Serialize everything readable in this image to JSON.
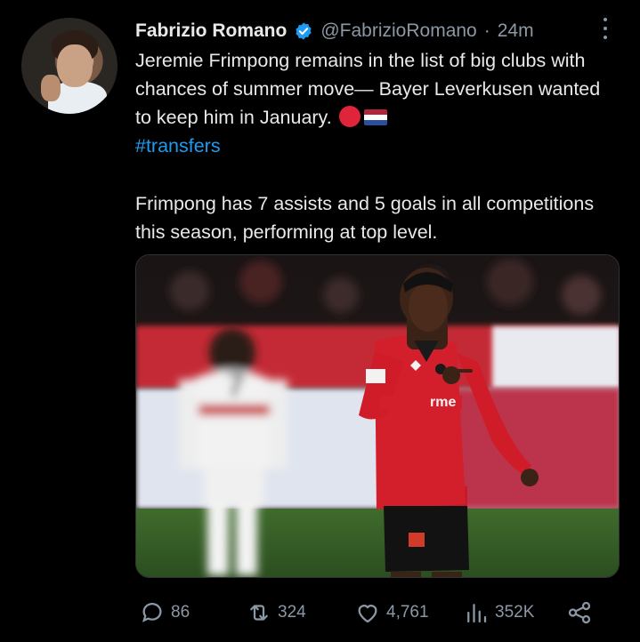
{
  "tweet": {
    "author": {
      "display_name": "Fabrizio Romano",
      "handle": "@FabrizioRomano",
      "separator": "·",
      "time_ago": "24m",
      "verified_icon": "verified-badge-icon"
    },
    "text": {
      "line1": "Jeremie Frimpong remains in the list of big clubs with chances of summer move— Bayer Leverkusen wanted to keep him in January.",
      "flags": [
        "red-circle-emoji",
        "netherlands-flag-emoji"
      ],
      "hashtag": "#transfers",
      "paragraph2": "Frimpong has 7 assists and 5 goals in all competitions this season, performing at top level."
    },
    "media": {
      "shirt_text": "rme",
      "back_number": "7"
    },
    "actions": {
      "replies": "86",
      "retweets": "324",
      "likes": "4,761",
      "views": "352K"
    }
  },
  "colors": {
    "background": "#000000",
    "text": "#e7e9ea",
    "secondary_text": "#8b98a5",
    "link": "#1d9bf0",
    "verified": "#1d9bf0",
    "kit_red": "#d21f2b"
  }
}
